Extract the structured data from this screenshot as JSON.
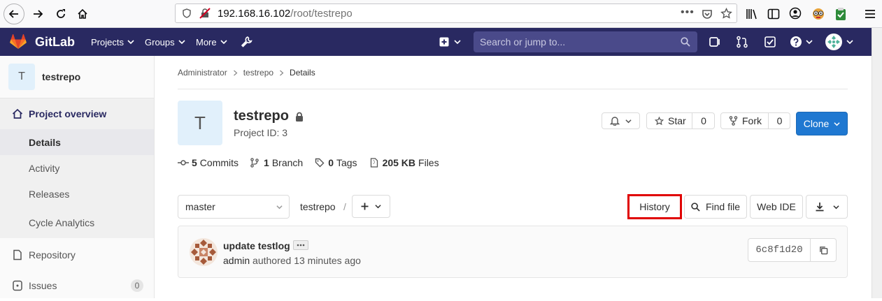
{
  "browser": {
    "url_host": "192.168.16.102",
    "url_path": "/root/testrepo"
  },
  "navbar": {
    "brand": "GitLab",
    "projects": "Projects",
    "groups": "Groups",
    "more": "More",
    "search_placeholder": "Search or jump to..."
  },
  "sidebar": {
    "avatar_letter": "T",
    "project_name": "testrepo",
    "overview": "Project overview",
    "items": [
      "Details",
      "Activity",
      "Releases",
      "Cycle Analytics"
    ],
    "repository": "Repository",
    "issues": "Issues",
    "issues_count": "0"
  },
  "breadcrumb": {
    "level1": "Administrator",
    "level2": "testrepo",
    "level3": "Details"
  },
  "project": {
    "avatar_letter": "T",
    "name": "testrepo",
    "id_text": "Project ID: 3"
  },
  "actions": {
    "star": "Star",
    "star_count": "0",
    "fork": "Fork",
    "fork_count": "0",
    "clone": "Clone"
  },
  "stats": {
    "commits_num": "5",
    "commits_label": "Commits",
    "branch_num": "1",
    "branch_label": "Branch",
    "tags_num": "0",
    "tags_label": "Tags",
    "files_num": "205 KB",
    "files_label": "Files"
  },
  "toolbar": {
    "branch": "master",
    "path": "testrepo",
    "separator": "/",
    "history": "History",
    "find_file": "Find file",
    "web_ide": "Web IDE"
  },
  "commit": {
    "title": "update testlog",
    "author": "admin",
    "authored": "authored 13 minutes ago",
    "sha": "6c8f1d20"
  }
}
